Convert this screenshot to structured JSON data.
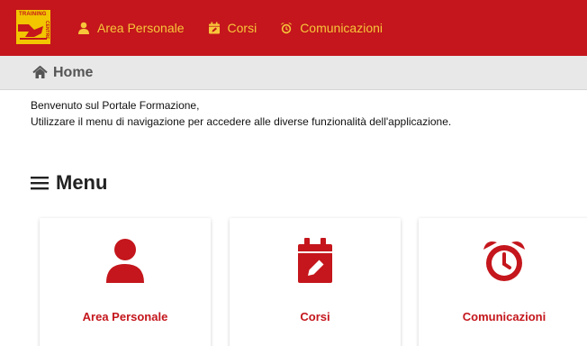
{
  "brand": {
    "logo_text_top": "TRAINING",
    "logo_text_side": "CENTRE",
    "colors": {
      "primary": "#c4161c",
      "accent": "#f7c63a",
      "logo_bg": "#f2c500"
    }
  },
  "navbar": {
    "items": [
      {
        "label": "Area Personale",
        "icon": "user-icon"
      },
      {
        "label": "Corsi",
        "icon": "calendar-edit-icon"
      },
      {
        "label": "Comunicazioni",
        "icon": "alarm-clock-icon"
      }
    ]
  },
  "breadcrumb": {
    "icon": "home-icon",
    "label": "Home"
  },
  "welcome": {
    "line1": "Benvenuto sul Portale Formazione,",
    "line2": "Utilizzare il menu di navigazione per accedere alle diverse funzionalità dell'applicazione."
  },
  "menu": {
    "icon": "hamburger-icon",
    "title": "Menu",
    "cards": [
      {
        "label": "Area Personale",
        "icon": "user-icon"
      },
      {
        "label": "Corsi",
        "icon": "calendar-edit-icon"
      },
      {
        "label": "Comunicazioni",
        "icon": "alarm-clock-icon"
      }
    ]
  }
}
